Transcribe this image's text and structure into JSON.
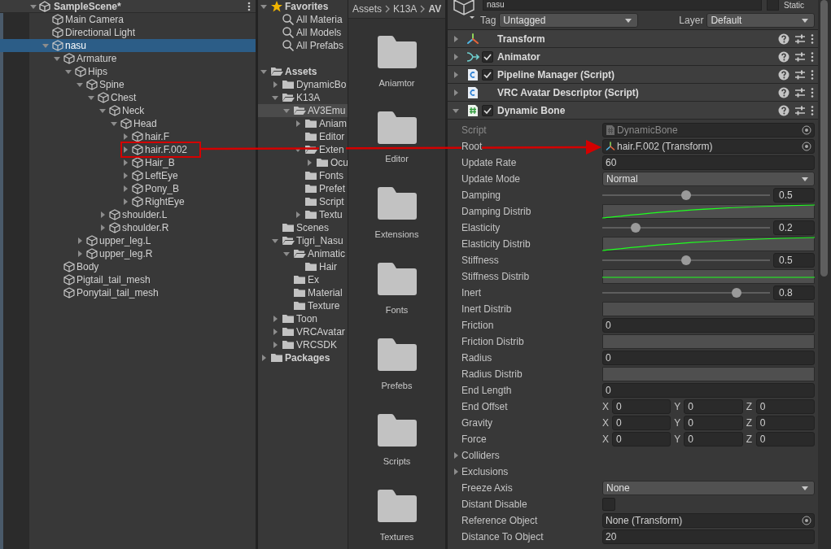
{
  "hierarchy": {
    "scene": {
      "name": "SampleScene*",
      "expanded": true
    },
    "items": [
      {
        "label": "Main Camera",
        "selected": false
      },
      {
        "label": "Directional Light",
        "selected": false
      },
      {
        "label": "nasu",
        "expanded": true,
        "selected": true,
        "children": [
          {
            "label": "Armature",
            "expanded": true,
            "selected": false,
            "children": [
              {
                "label": "Hips",
                "expanded": true,
                "selected": false,
                "children": [
                  {
                    "label": "Spine",
                    "expanded": true,
                    "selected": false,
                    "children": [
                      {
                        "label": "Chest",
                        "expanded": true,
                        "selected": false,
                        "children": [
                          {
                            "label": "Neck",
                            "expanded": true,
                            "selected": false,
                            "children": [
                              {
                                "label": "Head",
                                "expanded": true,
                                "selected": false,
                                "children": [
                                  {
                                    "label": "hair.F",
                                    "expanded": false,
                                    "selected": false
                                  },
                                  {
                                    "label": "hair.F.002",
                                    "expanded": false,
                                    "selected": false
                                  },
                                  {
                                    "label": "Hair_B",
                                    "expanded": false,
                                    "selected": false
                                  },
                                  {
                                    "label": "LeftEye",
                                    "expanded": false,
                                    "selected": false
                                  },
                                  {
                                    "label": "Pony_B",
                                    "expanded": false,
                                    "selected": false
                                  },
                                  {
                                    "label": "RightEye",
                                    "expanded": false,
                                    "selected": false
                                  }
                                ]
                              }
                            ]
                          },
                          {
                            "label": "shoulder.L",
                            "expanded": false,
                            "selected": false
                          },
                          {
                            "label": "shoulder.R",
                            "expanded": false,
                            "selected": false
                          }
                        ]
                      }
                    ]
                  },
                  {
                    "label": "upper_leg.L",
                    "expanded": false,
                    "selected": false
                  },
                  {
                    "label": "upper_leg.R",
                    "expanded": false,
                    "selected": false
                  }
                ]
              }
            ]
          },
          {
            "label": "Body",
            "selected": false
          },
          {
            "label": "Pigtail_tail_mesh",
            "selected": false
          },
          {
            "label": "Ponytail_tail_mesh",
            "selected": false
          }
        ]
      }
    ]
  },
  "project": {
    "favorites": {
      "label": "Favorites",
      "expanded": true,
      "items": [
        {
          "label": "All Materia",
          "selected": false
        },
        {
          "label": "All Models",
          "selected": false
        },
        {
          "label": "All Prefabs",
          "selected": false
        }
      ]
    },
    "tree": [
      {
        "label": "Assets",
        "expanded": true,
        "selected": false,
        "children": [
          {
            "label": "DynamicBo",
            "expanded": false,
            "selected": false
          },
          {
            "label": "K13A",
            "expanded": true,
            "selected": false,
            "children": [
              {
                "label": "AV3Emu",
                "expanded": true,
                "selected": true,
                "children": [
                  {
                    "label": "Aniam",
                    "expanded": false,
                    "selected": false
                  },
                  {
                    "label": "Editor",
                    "selected": false
                  },
                  {
                    "label": "Exten",
                    "expanded": true,
                    "selected": false,
                    "children": [
                      {
                        "label": "Ocu",
                        "expanded": false,
                        "selected": false
                      }
                    ]
                  },
                  {
                    "label": "Fonts",
                    "selected": false
                  },
                  {
                    "label": "Prefet",
                    "selected": false
                  },
                  {
                    "label": "Script",
                    "selected": false
                  },
                  {
                    "label": "Textu",
                    "expanded": false,
                    "selected": false
                  }
                ]
              }
            ]
          },
          {
            "label": "Scenes",
            "selected": false
          },
          {
            "label": "Tigri_Nasu",
            "expanded": true,
            "selected": false,
            "children": [
              {
                "label": "Animatic",
                "expanded": true,
                "selected": false,
                "children": [
                  {
                    "label": "Hair",
                    "selected": false
                  }
                ]
              },
              {
                "label": "Ex",
                "selected": false
              },
              {
                "label": "Material",
                "selected": false
              },
              {
                "label": "Texture",
                "selected": false
              }
            ]
          },
          {
            "label": "Toon",
            "expanded": false,
            "selected": false
          },
          {
            "label": "VRCAvatar",
            "expanded": false,
            "selected": false
          },
          {
            "label": "VRCSDK",
            "expanded": false,
            "selected": false
          }
        ]
      },
      {
        "label": "Packages",
        "expanded": false,
        "selected": false
      }
    ],
    "breadcrumb": [
      "Assets",
      "K13A",
      "AV"
    ],
    "folders": [
      "Aniamtor",
      "Editor",
      "Extensions",
      "Fonts",
      "Prefebs",
      "Scripts",
      "Textures"
    ]
  },
  "inspector": {
    "name": "nasu",
    "static": {
      "label": "Static",
      "checked": false
    },
    "tag": {
      "label": "Tag",
      "value": "Untagged"
    },
    "layer": {
      "label": "Layer",
      "value": "Default"
    },
    "components": [
      {
        "name": "Transform",
        "kind": "transform",
        "expanded": false
      },
      {
        "name": "Animator",
        "kind": "animator",
        "checked": true,
        "expanded": false
      },
      {
        "name": "Pipeline Manager (Script)",
        "kind": "script",
        "checked": true,
        "expanded": false
      },
      {
        "name": "VRC Avatar Descriptor (Script)",
        "kind": "script",
        "expanded": false
      },
      {
        "name": "Dynamic Bone",
        "kind": "bone",
        "checked": true,
        "expanded": true
      }
    ],
    "properties": [
      {
        "kind": "script",
        "label": "Script",
        "value": "DynamicBone"
      },
      {
        "kind": "transform",
        "label": "Root",
        "value": "hair.F.002 (Transform)"
      },
      {
        "kind": "number",
        "label": "Update Rate",
        "value": "60"
      },
      {
        "kind": "dropdown",
        "label": "Update Mode",
        "value": "Normal"
      },
      {
        "kind": "slider",
        "label": "Damping",
        "level": 0.5,
        "value": "0.5"
      },
      {
        "kind": "rampcurve",
        "label": "Damping Distrib"
      },
      {
        "kind": "slider",
        "label": "Elasticity",
        "level": 0.2,
        "value": "0.2"
      },
      {
        "kind": "rampcurve",
        "label": "Elasticity Distrib"
      },
      {
        "kind": "slider",
        "label": "Stiffness",
        "level": 0.5,
        "value": "0.5"
      },
      {
        "kind": "flatcurve",
        "label": "Stiffness Distrib"
      },
      {
        "kind": "slider",
        "label": "Inert",
        "level": 0.8,
        "value": "0.8"
      },
      {
        "kind": "emptycurve",
        "label": "Inert Distrib"
      },
      {
        "kind": "number",
        "label": "Friction",
        "value": "0"
      },
      {
        "kind": "emptycurve",
        "label": "Friction Distrib"
      },
      {
        "kind": "number",
        "label": "Radius",
        "value": "0"
      },
      {
        "kind": "emptycurve",
        "label": "Radius Distrib"
      },
      {
        "kind": "number",
        "label": "End Length",
        "value": "0"
      },
      {
        "kind": "vector",
        "label": "End Offset",
        "axes": [
          {
            "axis": "X",
            "value": "0"
          },
          {
            "axis": "Y",
            "value": "0"
          },
          {
            "axis": "Z",
            "value": "0"
          }
        ]
      },
      {
        "kind": "vector",
        "label": "Gravity",
        "axes": [
          {
            "axis": "X",
            "value": "0"
          },
          {
            "axis": "Y",
            "value": "0"
          },
          {
            "axis": "Z",
            "value": "0"
          }
        ]
      },
      {
        "kind": "vector",
        "label": "Force",
        "axes": [
          {
            "axis": "X",
            "value": "0"
          },
          {
            "axis": "Y",
            "value": "0"
          },
          {
            "axis": "Z",
            "value": "0"
          }
        ]
      },
      {
        "kind": "foldout",
        "label": "Colliders",
        "expanded": false
      },
      {
        "kind": "foldout",
        "label": "Exclusions",
        "expanded": false
      },
      {
        "kind": "dropdown",
        "label": "Freeze Axis",
        "value": "None"
      },
      {
        "kind": "checkbox",
        "label": "Distant Disable",
        "checked": false
      },
      {
        "kind": "object",
        "label": "Reference Object",
        "value": "None (Transform)"
      },
      {
        "kind": "number",
        "label": "Distance To Object",
        "value": "20"
      }
    ]
  }
}
